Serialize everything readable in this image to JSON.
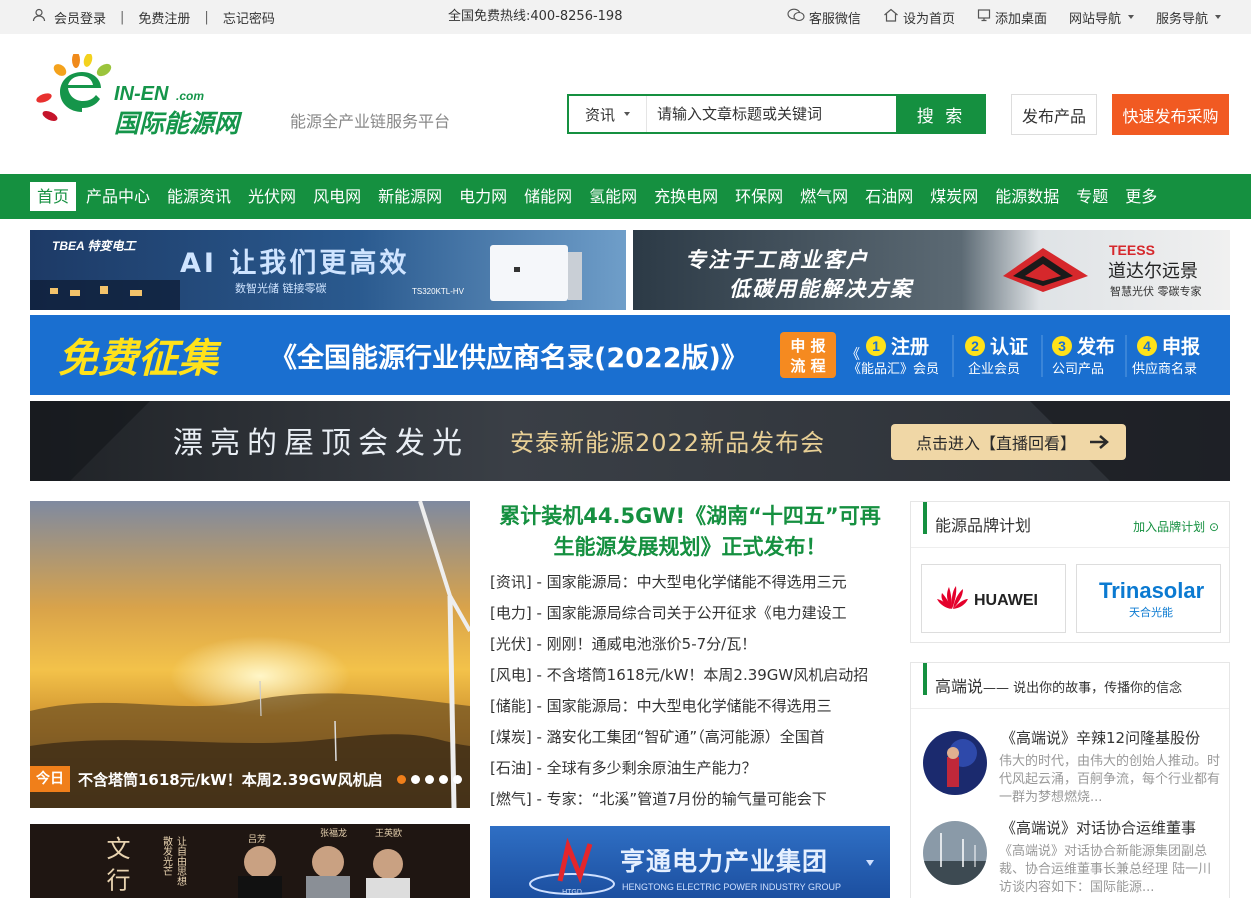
{
  "topbar": {
    "login": "会员登录",
    "register": "免费注册",
    "forgot": "忘记密码",
    "hotline": "全国免费热线:400-8256-198",
    "wechat": "客服微信",
    "homepage": "设为首页",
    "desktop": "添加桌面",
    "site_nav": "网站导航",
    "service_nav": "服务导航"
  },
  "header": {
    "logo_en": "IN-EN",
    "logo_com": ".com",
    "logo_cn": "国际能源网",
    "slogan": "能源全产业链服务平台",
    "search_type": "资讯",
    "search_placeholder": "请输入文章标题或关键词",
    "search_button": "搜 索",
    "publish_button": "发布产品",
    "fast_button": "快速发布采购"
  },
  "nav": [
    "首页",
    "产品中心",
    "能源资讯",
    "光伏网",
    "风电网",
    "新能源网",
    "电力网",
    "储能网",
    "氢能网",
    "充换电网",
    "环保网",
    "燃气网",
    "石油网",
    "煤炭网",
    "能源数据",
    "专题",
    "更多"
  ],
  "banners": {
    "b1": {
      "brand": "TBEA 特变电工",
      "title": "AI 让我们更高效",
      "sub": "数智光储  链接零碳",
      "model": "TS320KTL-HV"
    },
    "b2": {
      "line1": "专注于工商业客户",
      "line2": "低碳用能解决方案",
      "brand_en": "TEESS",
      "brand_cn": "道达尔远景",
      "tag": "智慧光伏  零碳专家"
    },
    "b3": {
      "big": "免费征集",
      "title": "《全国能源行业供应商名录(2022版)》",
      "flow1": "申 报",
      "flow2": "流 程",
      "steps": [
        {
          "n": "1",
          "t": "注册",
          "s": "《能品汇》会员"
        },
        {
          "n": "2",
          "t": "认证",
          "s": "企业会员"
        },
        {
          "n": "3",
          "t": "发布",
          "s": "公司产品"
        },
        {
          "n": "4",
          "t": "申报",
          "s": "供应商名录"
        }
      ]
    },
    "b4": {
      "left": "漂亮的屋顶会发光",
      "mid": "安泰新能源2022新品发布会",
      "btn": "点击进入【直播回看】"
    }
  },
  "slider": {
    "tag": "今日",
    "caption": "不含塔筒1618元/kW！本周2.39GW风机启"
  },
  "headline": "累计装机44.5GW!《湖南“十四五”可再生能源发展规划》正式发布！",
  "news": [
    "[资讯] - 国家能源局：中大型电化学储能不得选用三元",
    "[电力] - 国家能源局综合司关于公开征求《电力建设工",
    "[光伏] - 刚刚！通威电池涨价5-7分/瓦！",
    "[风电] - 不含塔筒1618元/kW！本周2.39GW风机启动招",
    "[储能] - 国家能源局：中大型电化学储能不得选用三",
    "[煤炭] - 潞安化工集团“智矿通”（高河能源）全国首",
    "[石油] - 全球有多少剩余原油生产能力？",
    "[燃气] - 专家：“北溪”管道7月份的输气量可能会下"
  ],
  "brand_panel": {
    "title": "能源品牌计划",
    "more": "加入品牌计划",
    "brands": [
      {
        "name": "HUAWEI"
      },
      {
        "name": "Trinasolar",
        "cn": "天合光能"
      }
    ]
  },
  "talk_panel": {
    "title": "高端说",
    "sub": "—— 说出你的故事，传播你的信念",
    "items": [
      {
        "title": "《高端说》辛辣12问隆基股份",
        "desc": "伟大的时代，由伟大的创始人推动。时代风起云涌，百舸争流，每个行业都有一群为梦想燃烧..."
      },
      {
        "title": "《高端说》对话协合运维董事",
        "desc": "《高端说》对话协合新能源集团副总裁、协合运维董事长兼总经理 陆一川 访谈内容如下：国际能源..."
      }
    ]
  },
  "bottom": {
    "b1_names": [
      "吕芳",
      "张福龙",
      "王英欧"
    ],
    "b1_slogan": [
      "让自由思想",
      "散发光芒"
    ],
    "b2_title": "亨通电力产业集团",
    "b2_en": "HENGTONG ELECTRIC POWER INDUSTRY GROUP",
    "b2_logo": "HTGD"
  }
}
